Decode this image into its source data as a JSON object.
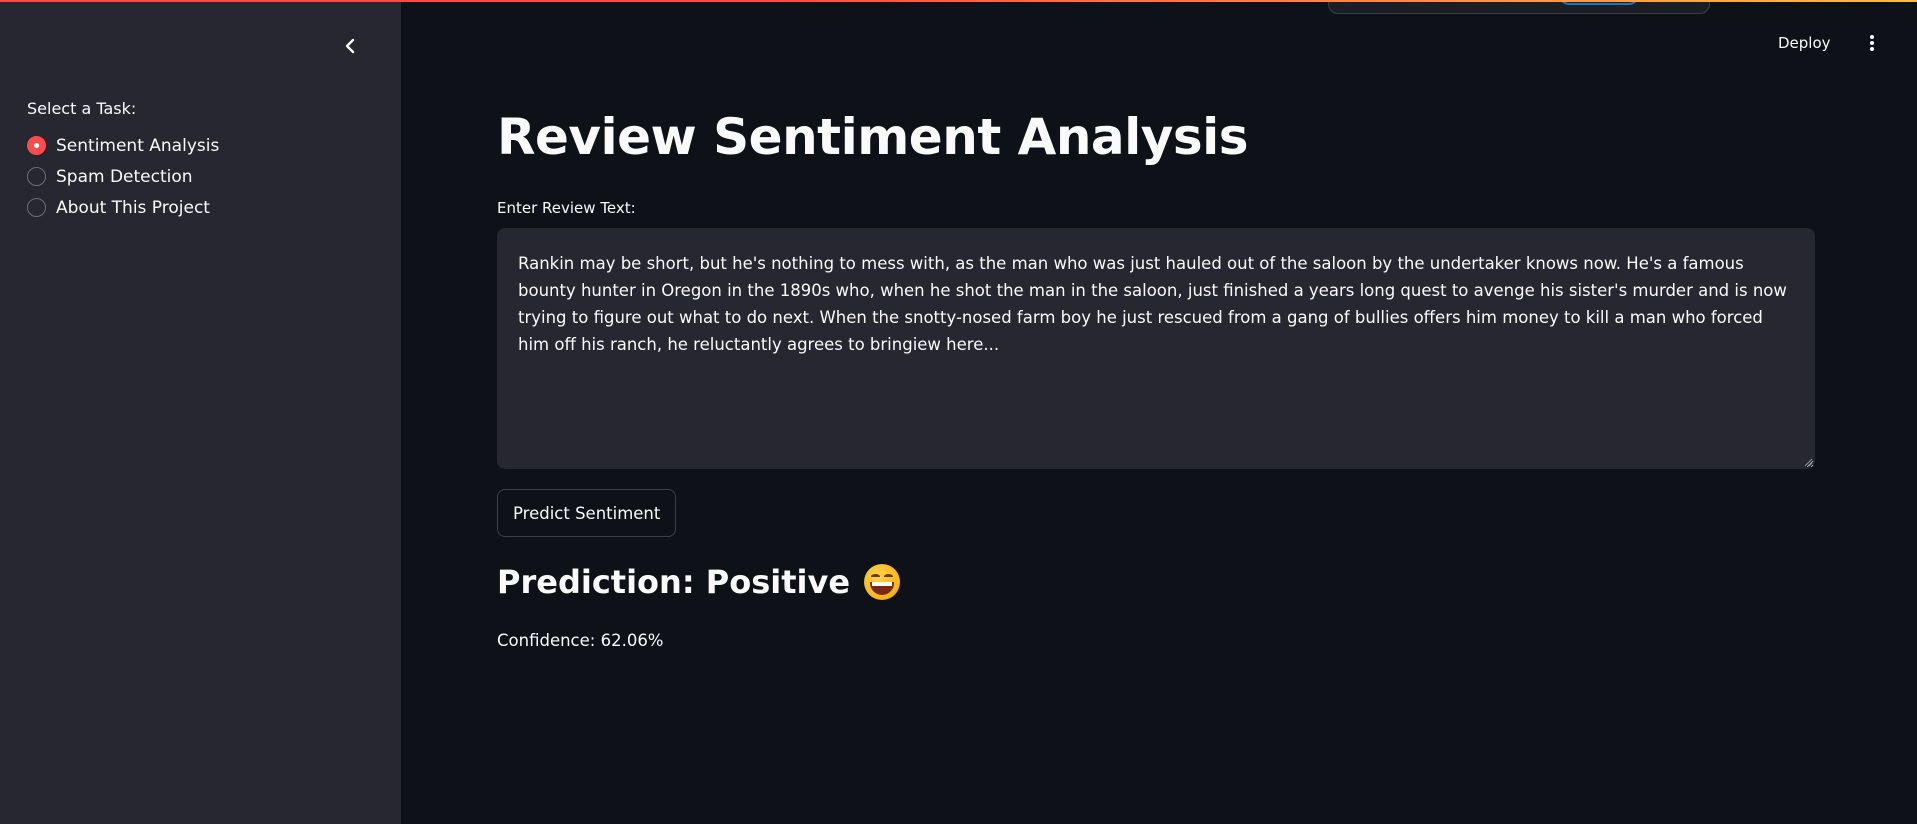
{
  "header": {
    "deploy_label": "Deploy",
    "menu_icon": "kebab-menu-icon"
  },
  "sidebar": {
    "collapse_icon": "chevron-left-icon",
    "radio_label": "Select a Task:",
    "options": [
      {
        "label": "Sentiment Analysis",
        "selected": true
      },
      {
        "label": "Spam Detection",
        "selected": false
      },
      {
        "label": "About This Project",
        "selected": false
      }
    ]
  },
  "main": {
    "title": "Review Sentiment Analysis",
    "input_label": "Enter Review Text:",
    "review_text": " Rankin may be short, but he's nothing to mess with, as the man who was just hauled out of the saloon by the undertaker knows now. He's a famous bounty hunter in Oregon in the 1890s who, when he shot the man in the saloon, just finished a years long quest to avenge his sister's murder and is now trying to figure out what to do next. When the snotty-nosed farm boy he just rescued from a gang of bullies offers him money to kill a man who forced him off his ranch, he reluctantly agrees to bringiew  here...",
    "predict_button": "Predict Sentiment",
    "prediction_text": "Prediction: Positive",
    "prediction_emoji": "grinning-face-icon",
    "confidence_text": "Confidence: 62.06%"
  },
  "colors": {
    "accent": "#ff4b4b",
    "background": "#0e1117",
    "sidebar": "#262730",
    "text": "#fafafa"
  }
}
